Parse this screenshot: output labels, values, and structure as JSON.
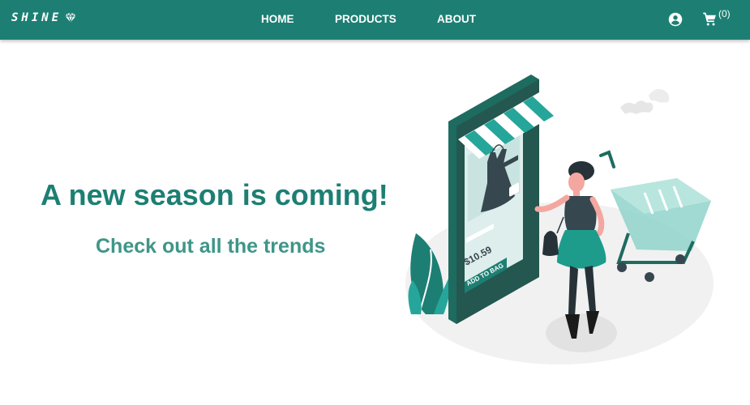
{
  "brand": {
    "name": "SHINE",
    "icon": "diamond-icon"
  },
  "nav": {
    "links": [
      {
        "label": "HOME"
      },
      {
        "label": "PRODUCTS"
      },
      {
        "label": "ABOUT"
      }
    ],
    "account_icon": "account-circle-icon",
    "cart_icon": "shopping-cart-icon",
    "cart_count": "(0)"
  },
  "hero": {
    "title": "A new season is coming!",
    "subtitle": "Check out all the trends"
  },
  "illustration": {
    "price": "$10.59",
    "button_label": "ADD TO BAG"
  },
  "colors": {
    "brand": "#1d7f73",
    "accent": "#26a69a",
    "subtitle": "#3e9688"
  }
}
